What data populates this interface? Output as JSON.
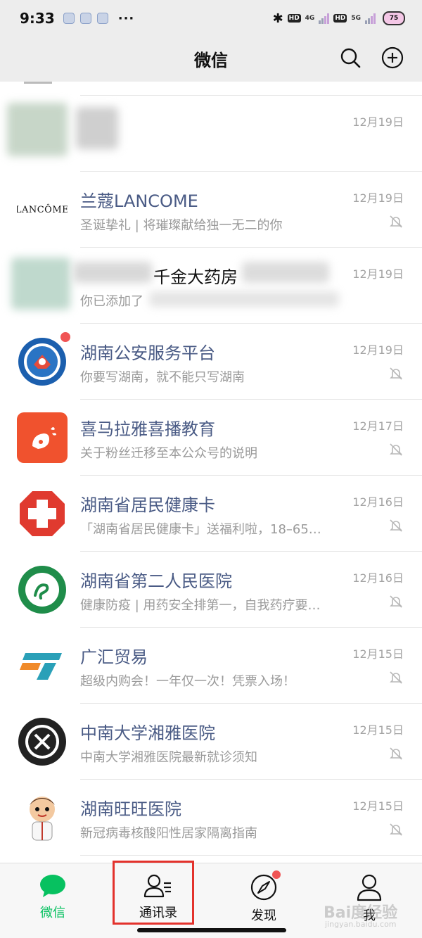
{
  "status_bar": {
    "time": "9:33",
    "more": "···",
    "net1": "4G",
    "net2": "5G",
    "hd": "HD",
    "battery": "75"
  },
  "header": {
    "title": "微信"
  },
  "chats": [
    {
      "name": "",
      "preview": "",
      "date": "12月19日",
      "muted": false
    },
    {
      "name": "兰蔻LANCOME",
      "avatar_text": "LANCÔME",
      "preview": "圣诞挚礼 | 将璀璨献给独一无二的你",
      "date": "12月19日",
      "muted": true
    },
    {
      "name": "千金大药房",
      "preview": "你已添加了",
      "date": "12月19日",
      "muted": false
    },
    {
      "name": "湖南公安服务平台",
      "preview": "你要写湖南，就不能只写湖南",
      "date": "12月19日",
      "muted": true,
      "unread": true
    },
    {
      "name": "喜马拉雅喜播教育",
      "preview": "关于粉丝迁移至本公众号的说明",
      "date": "12月17日",
      "muted": true
    },
    {
      "name": "湖南省居民健康卡",
      "preview": "「湖南省居民健康卡」送福利啦，18–65…",
      "date": "12月16日",
      "muted": true
    },
    {
      "name": "湖南省第二人民医院",
      "preview": "健康防疫 | 用药安全排第一，自我药疗要…",
      "date": "12月16日",
      "muted": true
    },
    {
      "name": "广汇贸易",
      "preview": "超级内购会！一年仅一次！凭票入场！",
      "date": "12月15日",
      "muted": true
    },
    {
      "name": "中南大学湘雅医院",
      "preview": "中南大学湘雅医院最新就诊须知",
      "date": "12月15日",
      "muted": true
    },
    {
      "name": "湖南旺旺医院",
      "preview": "新冠病毒核酸阳性居家隔离指南",
      "date": "12月15日",
      "muted": true
    }
  ],
  "tabs": [
    {
      "label": "微信",
      "icon": "chat-bubble-icon",
      "active": true
    },
    {
      "label": "通讯录",
      "icon": "contacts-icon",
      "active": false,
      "highlighted": true
    },
    {
      "label": "发现",
      "icon": "compass-icon",
      "active": false,
      "badge": true
    },
    {
      "label": "我",
      "icon": "person-icon",
      "active": false
    }
  ],
  "watermark": {
    "main": "Bai度经验",
    "sub": "jingyan.baidu.com"
  },
  "colors": {
    "accent_green": "#07c160",
    "name_blue": "#4a5b85",
    "badge_red": "#f05454",
    "highlight_red": "#e3322c"
  }
}
